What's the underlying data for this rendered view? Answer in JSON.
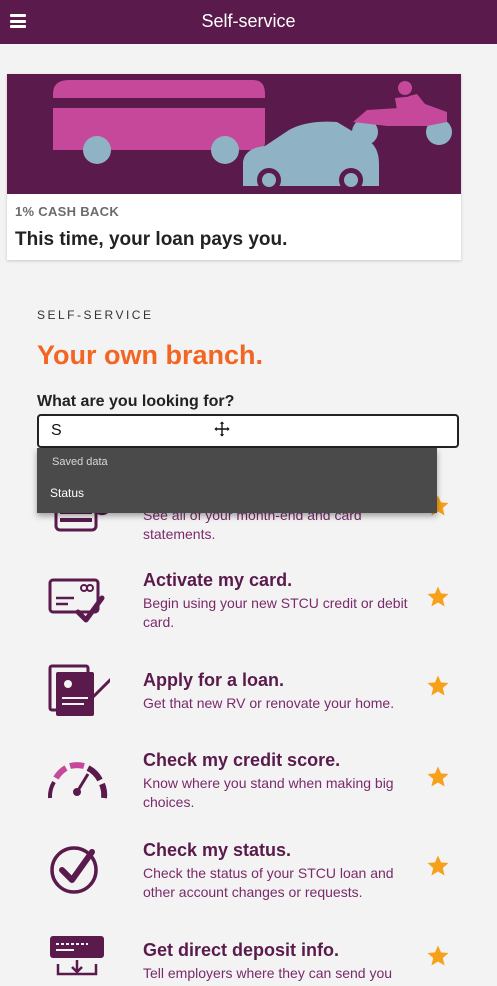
{
  "app": {
    "title": "Self-service"
  },
  "promo": {
    "eyebrow": "1% CASH BACK",
    "headline": "This time, your loan pays you."
  },
  "section": {
    "eyebrow": "SELF-SERVICE",
    "title": "Your own branch."
  },
  "search": {
    "label": "What are you looking for?",
    "value": "S"
  },
  "autocomplete": {
    "header": "Saved data",
    "options": [
      "Status"
    ]
  },
  "services": [
    {
      "title": "",
      "description": "See all of your month-end and card statements.",
      "icon": "statements-icon"
    },
    {
      "title": "Activate my card.",
      "description": "Begin using your new STCU credit or debit card.",
      "icon": "card-check-icon"
    },
    {
      "title": "Apply for a loan.",
      "description": "Get that new RV or renovate your home.",
      "icon": "loan-document-icon"
    },
    {
      "title": "Check my credit score.",
      "description": "Know where you stand when making big choices.",
      "icon": "credit-gauge-icon"
    },
    {
      "title": "Check my status.",
      "description": "Check the status of your STCU loan and other account changes or requests.",
      "icon": "status-check-icon"
    },
    {
      "title": "Get direct deposit info.",
      "description": "Tell employers where they can send you cash.",
      "icon": "direct-deposit-icon"
    }
  ],
  "colors": {
    "brand": "#5a1a4c",
    "accent": "#f26522",
    "star": "#f7a11a"
  }
}
